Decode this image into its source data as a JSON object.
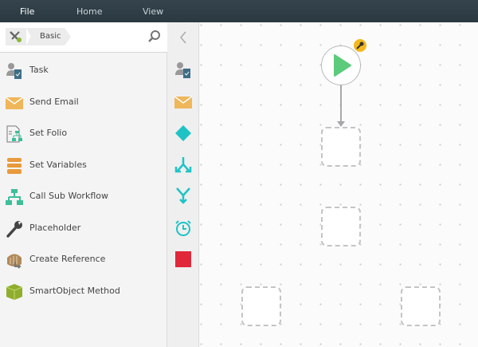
{
  "menu": {
    "tabs": [
      {
        "label": "File"
      },
      {
        "label": "Home"
      },
      {
        "label": "View"
      }
    ]
  },
  "toolbox": {
    "breadcrumb": "Basic",
    "items": [
      {
        "label": "Task",
        "icon": "task-icon"
      },
      {
        "label": "Send Email",
        "icon": "email-icon"
      },
      {
        "label": "Set Folio",
        "icon": "folio-icon"
      },
      {
        "label": "Set Variables",
        "icon": "variables-icon"
      },
      {
        "label": "Call Sub Workflow",
        "icon": "sub-workflow-icon"
      },
      {
        "label": "Placeholder",
        "icon": "wrench-icon"
      },
      {
        "label": "Create Reference",
        "icon": "reference-icon"
      },
      {
        "label": "SmartObject Method",
        "icon": "smartobject-icon"
      }
    ]
  },
  "colors": {
    "teal": "#1fc3c5",
    "green": "#5ccb7c",
    "red": "#e0283a",
    "orange": "#e89a3c",
    "badge": "#f3b81c"
  }
}
